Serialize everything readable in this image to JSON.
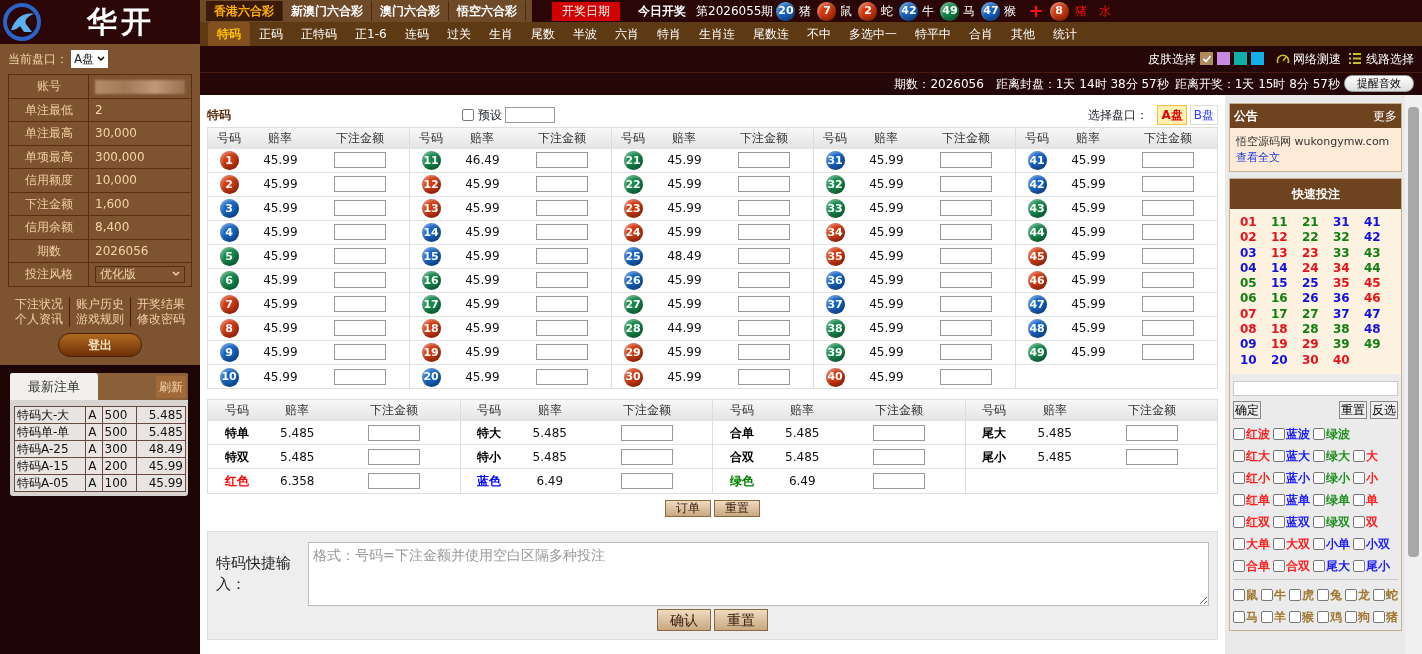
{
  "logo": {
    "title": "华开"
  },
  "lottery_tabs": [
    {
      "label": "香港六合彩",
      "selected": true
    },
    {
      "label": "新澳门六合彩",
      "selected": false
    },
    {
      "label": "澳门六合彩",
      "selected": false
    },
    {
      "label": "悟空六合彩",
      "selected": false
    }
  ],
  "draw_date_button": "开奖日期",
  "today_draw_label": "今日开奖",
  "last_draw": {
    "period": "第2026055期",
    "balls": [
      {
        "number": "20",
        "zodiac": "猪",
        "color": "#1565c8"
      },
      {
        "number": "7",
        "zodiac": "鼠",
        "color": "#d4380f"
      },
      {
        "number": "2",
        "zodiac": "蛇",
        "color": "#d4380f"
      },
      {
        "number": "42",
        "zodiac": "牛",
        "color": "#1565c8"
      },
      {
        "number": "49",
        "zodiac": "马",
        "color": "#138a4a"
      },
      {
        "number": "47",
        "zodiac": "猴",
        "color": "#1565c8"
      }
    ],
    "plus": "+",
    "special": {
      "number": "8",
      "zodiac": "猪",
      "element": "水",
      "color": "#d4380f"
    }
  },
  "game_tabs": [
    {
      "label": "特码",
      "selected": true
    },
    {
      "label": "正码",
      "selected": false
    },
    {
      "label": "正特码",
      "selected": false
    },
    {
      "label": "正1-6",
      "selected": false
    },
    {
      "label": "连码",
      "selected": false
    },
    {
      "label": "过关",
      "selected": false
    },
    {
      "label": "生肖",
      "selected": false
    },
    {
      "label": "尾数",
      "selected": false
    },
    {
      "label": "半波",
      "selected": false
    },
    {
      "label": "六肖",
      "selected": false
    },
    {
      "label": "特肖",
      "selected": false
    },
    {
      "label": "生肖连",
      "selected": false
    },
    {
      "label": "尾数连",
      "selected": false
    },
    {
      "label": "不中",
      "selected": false
    },
    {
      "label": "多选中一",
      "selected": false
    },
    {
      "label": "特平中",
      "selected": false
    },
    {
      "label": "合肖",
      "selected": false
    },
    {
      "label": "其他",
      "selected": false
    },
    {
      "label": "统计",
      "selected": false
    }
  ],
  "skin": {
    "label": "皮肤选择",
    "swatches": [
      {
        "color": "#b08a58",
        "selected": true
      },
      {
        "color": "#c88ae0",
        "selected": false
      },
      {
        "color": "#10b0a8",
        "selected": false
      },
      {
        "color": "#12b0e8",
        "selected": false
      }
    ],
    "speed_test": "网络测速",
    "line_select": "线路选择"
  },
  "countdown": {
    "period": "期数：2026056",
    "close": "距离封盘：1天 14时 38分 57秒",
    "draw": "距离开奖：1天 15时 8分 57秒",
    "sound_button": "提醒音效"
  },
  "sidebar": {
    "plate_label": "当前盘口：",
    "plate_value": "A盘",
    "account_rows": [
      {
        "label": "账号",
        "kind": "redacted"
      },
      {
        "label": "单注最低",
        "kind": "text",
        "value": "2"
      },
      {
        "label": "单注最高",
        "kind": "text",
        "value": "30,000"
      },
      {
        "label": "单项最高",
        "kind": "text",
        "value": "300,000"
      },
      {
        "label": "信用额度",
        "kind": "text",
        "value": "10,000"
      },
      {
        "label": "下注金额",
        "kind": "text",
        "value": "1,600"
      },
      {
        "label": "信用余额",
        "kind": "text",
        "value": "8,400"
      },
      {
        "label": "期数",
        "kind": "text",
        "value": "2026056"
      },
      {
        "label": "投注风格",
        "kind": "select",
        "value": "优化版"
      }
    ],
    "links": [
      "下注状况",
      "账户历史",
      "开奖结果",
      "个人资讯",
      "游戏规则",
      "修改密码"
    ],
    "logout_button": "登出"
  },
  "recent_bets": {
    "tab": "最新注单",
    "refresh": "刷新",
    "rows": [
      [
        "特码大-大",
        "A",
        "500",
        "5.485"
      ],
      [
        "特码单-单",
        "A",
        "500",
        "5.485"
      ],
      [
        "特码A-25",
        "A",
        "300",
        "48.49"
      ],
      [
        "特码A-15",
        "A",
        "200",
        "45.99"
      ],
      [
        "特码A-05",
        "A",
        "100",
        "45.99"
      ]
    ]
  },
  "main": {
    "title": "特码",
    "preset": {
      "label": "预设",
      "checked": false
    },
    "plate_label": "选择盘口：",
    "plates": [
      {
        "label": "A盘",
        "selected": true
      },
      {
        "label": "B盘",
        "selected": false
      }
    ],
    "number_groups": [
      {
        "columns": [
          "号码",
          "赔率",
          "下注金额"
        ],
        "rows": [
          {
            "number": "1",
            "odds": "45.99",
            "color": "#d4380f"
          },
          {
            "number": "2",
            "odds": "45.99",
            "color": "#d4380f"
          },
          {
            "number": "3",
            "odds": "45.99",
            "color": "#1565c8"
          },
          {
            "number": "4",
            "odds": "45.99",
            "color": "#1565c8"
          },
          {
            "number": "5",
            "odds": "45.99",
            "color": "#138a4a"
          },
          {
            "number": "6",
            "odds": "45.99",
            "color": "#138a4a"
          },
          {
            "number": "7",
            "odds": "45.99",
            "color": "#d4380f"
          },
          {
            "number": "8",
            "odds": "45.99",
            "color": "#d4380f"
          },
          {
            "number": "9",
            "odds": "45.99",
            "color": "#1565c8"
          },
          {
            "number": "10",
            "odds": "45.99",
            "color": "#1565c8"
          }
        ]
      },
      {
        "columns": [
          "号码",
          "赔率",
          "下注金额"
        ],
        "rows": [
          {
            "number": "11",
            "odds": "46.49",
            "color": "#138a4a"
          },
          {
            "number": "12",
            "odds": "45.99",
            "color": "#d4380f"
          },
          {
            "number": "13",
            "odds": "45.99",
            "color": "#d4380f"
          },
          {
            "number": "14",
            "odds": "45.99",
            "color": "#1565c8"
          },
          {
            "number": "15",
            "odds": "45.99",
            "color": "#1565c8"
          },
          {
            "number": "16",
            "odds": "45.99",
            "color": "#138a4a"
          },
          {
            "number": "17",
            "odds": "45.99",
            "color": "#138a4a"
          },
          {
            "number": "18",
            "odds": "45.99",
            "color": "#d4380f"
          },
          {
            "number": "19",
            "odds": "45.99",
            "color": "#d4380f"
          },
          {
            "number": "20",
            "odds": "45.99",
            "color": "#1565c8"
          }
        ]
      },
      {
        "columns": [
          "号码",
          "赔率",
          "下注金额"
        ],
        "rows": [
          {
            "number": "21",
            "odds": "45.99",
            "color": "#138a4a"
          },
          {
            "number": "22",
            "odds": "45.99",
            "color": "#138a4a"
          },
          {
            "number": "23",
            "odds": "45.99",
            "color": "#d4380f"
          },
          {
            "number": "24",
            "odds": "45.99",
            "color": "#d4380f"
          },
          {
            "number": "25",
            "odds": "48.49",
            "color": "#1565c8"
          },
          {
            "number": "26",
            "odds": "45.99",
            "color": "#1565c8"
          },
          {
            "number": "27",
            "odds": "45.99",
            "color": "#138a4a"
          },
          {
            "number": "28",
            "odds": "44.99",
            "color": "#138a4a"
          },
          {
            "number": "29",
            "odds": "45.99",
            "color": "#d4380f"
          },
          {
            "number": "30",
            "odds": "45.99",
            "color": "#d4380f"
          }
        ]
      },
      {
        "columns": [
          "号码",
          "赔率",
          "下注金额"
        ],
        "rows": [
          {
            "number": "31",
            "odds": "45.99",
            "color": "#1565c8"
          },
          {
            "number": "32",
            "odds": "45.99",
            "color": "#138a4a"
          },
          {
            "number": "33",
            "odds": "45.99",
            "color": "#138a4a"
          },
          {
            "number": "34",
            "odds": "45.99",
            "color": "#d4380f"
          },
          {
            "number": "35",
            "odds": "45.99",
            "color": "#d4380f"
          },
          {
            "number": "36",
            "odds": "45.99",
            "color": "#1565c8"
          },
          {
            "number": "37",
            "odds": "45.99",
            "color": "#1565c8"
          },
          {
            "number": "38",
            "odds": "45.99",
            "color": "#138a4a"
          },
          {
            "number": "39",
            "odds": "45.99",
            "color": "#138a4a"
          },
          {
            "number": "40",
            "odds": "45.99",
            "color": "#d4380f"
          }
        ]
      },
      {
        "columns": [
          "号码",
          "赔率",
          "下注金额"
        ],
        "rows": [
          {
            "number": "41",
            "odds": "45.99",
            "color": "#1565c8"
          },
          {
            "number": "42",
            "odds": "45.99",
            "color": "#1565c8"
          },
          {
            "number": "43",
            "odds": "45.99",
            "color": "#138a4a"
          },
          {
            "number": "44",
            "odds": "45.99",
            "color": "#138a4a"
          },
          {
            "number": "45",
            "odds": "45.99",
            "color": "#d4380f"
          },
          {
            "number": "46",
            "odds": "45.99",
            "color": "#d4380f"
          },
          {
            "number": "47",
            "odds": "45.99",
            "color": "#1565c8"
          },
          {
            "number": "48",
            "odds": "45.99",
            "color": "#1565c8"
          },
          {
            "number": "49",
            "odds": "45.99",
            "color": "#138a4a"
          }
        ]
      }
    ],
    "option_groups": [
      {
        "columns": [
          "号码",
          "赔率",
          "下注金额"
        ],
        "rows": [
          {
            "label": "特单",
            "odds": "5.485",
            "color": "#000000"
          },
          {
            "label": "特双",
            "odds": "5.485",
            "color": "#000000"
          },
          {
            "label": "红色",
            "odds": "6.358",
            "color": "#ff0000"
          }
        ]
      },
      {
        "columns": [
          "号码",
          "赔率",
          "下注金额"
        ],
        "rows": [
          {
            "label": "特大",
            "odds": "5.485",
            "color": "#000000"
          },
          {
            "label": "特小",
            "odds": "5.485",
            "color": "#000000"
          },
          {
            "label": "蓝色",
            "odds": "6.49",
            "color": "#0000ff"
          }
        ]
      },
      {
        "columns": [
          "号码",
          "赔率",
          "下注金额"
        ],
        "rows": [
          {
            "label": "合单",
            "odds": "5.485",
            "color": "#000000"
          },
          {
            "label": "合双",
            "odds": "5.485",
            "color": "#000000"
          },
          {
            "label": "绿色",
            "odds": "6.49",
            "color": "#008000"
          }
        ]
      },
      {
        "columns": [
          "号码",
          "赔率",
          "下注金额"
        ],
        "rows": [
          {
            "label": "尾大",
            "odds": "5.485",
            "color": "#000000"
          },
          {
            "label": "尾小",
            "odds": "5.485",
            "color": "#000000"
          }
        ]
      }
    ],
    "buttons": [
      "订单",
      "重置"
    ],
    "quick_input": {
      "label": "特码快捷输入：",
      "placeholder": "格式：号码=下注金额并使用空白区隔多种投注",
      "buttons": [
        "确认",
        "重置"
      ]
    }
  },
  "notice": {
    "title": "公告",
    "more": "更多",
    "text": "悟空源码网 wukongymw.com",
    "link": "查看全文"
  },
  "quick_bet": {
    "title": "快速投注",
    "numbers": [
      {
        "label": "01",
        "color": "#e8101a"
      },
      {
        "label": "11",
        "color": "#108010"
      },
      {
        "label": "21",
        "color": "#108010"
      },
      {
        "label": "31",
        "color": "#1010e0"
      },
      {
        "label": "41",
        "color": "#1010e0"
      },
      {
        "label": "02",
        "color": "#e8101a"
      },
      {
        "label": "12",
        "color": "#e8101a"
      },
      {
        "label": "22",
        "color": "#108010"
      },
      {
        "label": "32",
        "color": "#108010"
      },
      {
        "label": "42",
        "color": "#1010e0"
      },
      {
        "label": "03",
        "color": "#1010e0"
      },
      {
        "label": "13",
        "color": "#e8101a"
      },
      {
        "label": "23",
        "color": "#e8101a"
      },
      {
        "label": "33",
        "color": "#108010"
      },
      {
        "label": "43",
        "color": "#108010"
      },
      {
        "label": "04",
        "color": "#1010e0"
      },
      {
        "label": "14",
        "color": "#1010e0"
      },
      {
        "label": "24",
        "color": "#e8101a"
      },
      {
        "label": "34",
        "color": "#e8101a"
      },
      {
        "label": "44",
        "color": "#108010"
      },
      {
        "label": "05",
        "color": "#108010"
      },
      {
        "label": "15",
        "color": "#1010e0"
      },
      {
        "label": "25",
        "color": "#1010e0"
      },
      {
        "label": "35",
        "color": "#e8101a"
      },
      {
        "label": "45",
        "color": "#e8101a"
      },
      {
        "label": "06",
        "color": "#108010"
      },
      {
        "label": "16",
        "color": "#108010"
      },
      {
        "label": "26",
        "color": "#1010e0"
      },
      {
        "label": "36",
        "color": "#1010e0"
      },
      {
        "label": "46",
        "color": "#e8101a"
      },
      {
        "label": "07",
        "color": "#e8101a"
      },
      {
        "label": "17",
        "color": "#108010"
      },
      {
        "label": "27",
        "color": "#108010"
      },
      {
        "label": "37",
        "color": "#1010e0"
      },
      {
        "label": "47",
        "color": "#1010e0"
      },
      {
        "label": "08",
        "color": "#e8101a"
      },
      {
        "label": "18",
        "color": "#e8101a"
      },
      {
        "label": "28",
        "color": "#108010"
      },
      {
        "label": "38",
        "color": "#108010"
      },
      {
        "label": "48",
        "color": "#1010e0"
      },
      {
        "label": "09",
        "color": "#1010e0"
      },
      {
        "label": "19",
        "color": "#e8101a"
      },
      {
        "label": "29",
        "color": "#e8101a"
      },
      {
        "label": "39",
        "color": "#108010"
      },
      {
        "label": "49",
        "color": "#108010"
      },
      {
        "label": "10",
        "color": "#1010e0"
      },
      {
        "label": "20",
        "color": "#1010e0"
      },
      {
        "label": "30",
        "color": "#e8101a"
      },
      {
        "label": "40",
        "color": "#e8101a"
      }
    ],
    "confirm": "确定",
    "reset": "重置",
    "invert": "反选",
    "checkbox_rows": [
      [
        {
          "label": "红波",
          "color": "#ff2020",
          "checked": false
        },
        {
          "label": "蓝波",
          "color": "#2020ff",
          "checked": false
        },
        {
          "label": "绿波",
          "color": "#229022",
          "checked": false
        }
      ],
      [
        {
          "label": "红大",
          "color": "#ff2020",
          "checked": false
        },
        {
          "label": "蓝大",
          "color": "#2020ff",
          "checked": false
        },
        {
          "label": "绿大",
          "color": "#229022",
          "checked": false
        },
        {
          "label": "大",
          "color": "#ff2020",
          "checked": false
        }
      ],
      [
        {
          "label": "红小",
          "color": "#ff2020",
          "checked": false
        },
        {
          "label": "蓝小",
          "color": "#2020ff",
          "checked": false
        },
        {
          "label": "绿小",
          "color": "#229022",
          "checked": false
        },
        {
          "label": "小",
          "color": "#ff2020",
          "checked": false
        }
      ],
      [
        {
          "label": "红单",
          "color": "#ff2020",
          "checked": false
        },
        {
          "label": "蓝单",
          "color": "#2020ff",
          "checked": false
        },
        {
          "label": "绿单",
          "color": "#229022",
          "checked": false
        },
        {
          "label": "单",
          "color": "#ff2020",
          "checked": false
        }
      ],
      [
        {
          "label": "红双",
          "color": "#ff2020",
          "checked": false
        },
        {
          "label": "蓝双",
          "color": "#2020ff",
          "checked": false
        },
        {
          "label": "绿双",
          "color": "#229022",
          "checked": false
        },
        {
          "label": "双",
          "color": "#ff2020",
          "checked": false
        }
      ],
      [
        {
          "label": "大单",
          "color": "#ff2020",
          "checked": false
        },
        {
          "label": "大双",
          "color": "#ff2020",
          "checked": false
        },
        {
          "label": "小单",
          "color": "#2020ff",
          "checked": false
        },
        {
          "label": "小双",
          "color": "#2020ff",
          "checked": false
        }
      ],
      [
        {
          "label": "合单",
          "color": "#ff2020",
          "checked": false
        },
        {
          "label": "合双",
          "color": "#ff2020",
          "checked": false
        },
        {
          "label": "尾大",
          "color": "#2020ff",
          "checked": false
        },
        {
          "label": "尾小",
          "color": "#2020ff",
          "checked": false
        }
      ]
    ],
    "zodiac_rows": [
      [
        {
          "label": "鼠",
          "checked": false
        },
        {
          "label": "牛",
          "checked": false
        },
        {
          "label": "虎",
          "checked": false
        },
        {
          "label": "兔",
          "checked": false
        },
        {
          "label": "龙",
          "checked": false
        },
        {
          "label": "蛇",
          "checked": false
        }
      ],
      [
        {
          "label": "马",
          "checked": false
        },
        {
          "label": "羊",
          "checked": false
        },
        {
          "label": "猴",
          "checked": false
        },
        {
          "label": "鸡",
          "checked": false
        },
        {
          "label": "狗",
          "checked": false
        },
        {
          "label": "猪",
          "checked": false
        }
      ]
    ]
  }
}
